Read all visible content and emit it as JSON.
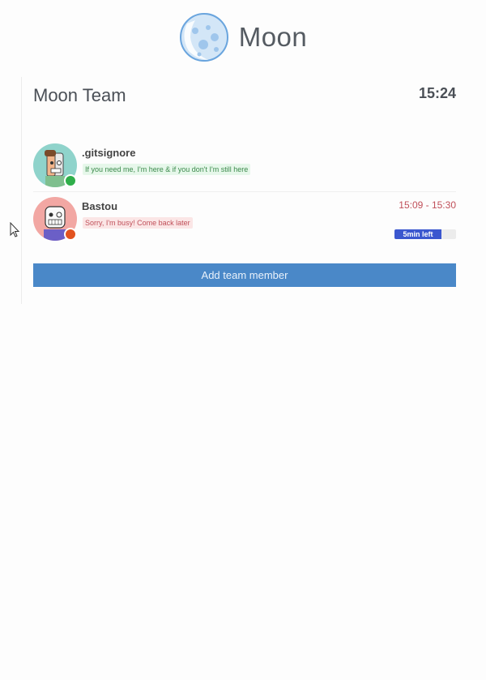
{
  "app": {
    "name": "Moon",
    "logo_icon": "moon-logo-icon"
  },
  "panel": {
    "title": "Moon Team",
    "clock": "15:24"
  },
  "members": [
    {
      "name": ".gitsignore",
      "message": "If you need me, I'm here & if you don't I'm still here",
      "status": "available",
      "status_color": "#2fae4a",
      "avatar_icon": "robot-avatar-icon"
    },
    {
      "name": "Bastou",
      "message": "Sorry, I'm busy! Come back later",
      "status": "busy",
      "status_color": "#e2531f",
      "avatar_icon": "robot-avatar-icon",
      "time_range": "15:09 - 15:30",
      "time_left_label": "5min left",
      "time_left_fraction": 0.76
    }
  ],
  "actions": {
    "add_member_label": "Add team member"
  },
  "colors": {
    "accent": "#4a88c8",
    "busy_text": "#c0505a",
    "available_text": "#3c8a4c",
    "countdown": "#3b57cf"
  }
}
